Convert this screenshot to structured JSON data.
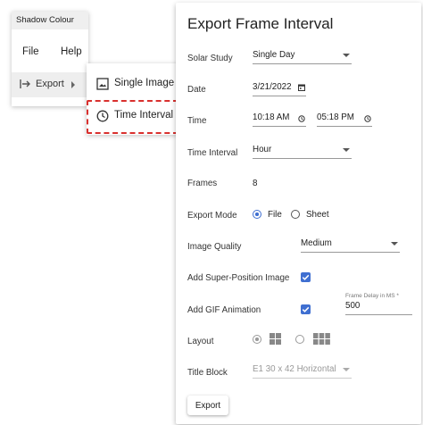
{
  "app": {
    "title": "Shadow Colour",
    "menu": [
      "File",
      "Help"
    ],
    "export_label": "Export"
  },
  "submenu": {
    "items": [
      {
        "label": "Single Image",
        "icon": "image-icon"
      },
      {
        "label": "Time Interval",
        "icon": "clock-icon"
      }
    ],
    "highlight_color": "#d9302e"
  },
  "dialog": {
    "title": "Export Frame Interval",
    "solar_study": {
      "label": "Solar Study",
      "value": "Single Day"
    },
    "date": {
      "label": "Date",
      "value": "3/21/2022"
    },
    "time": {
      "label": "Time",
      "start": "10:18 AM",
      "end": "05:18 PM"
    },
    "time_interval": {
      "label": "Time Interval",
      "value": "Hour"
    },
    "frames": {
      "label": "Frames",
      "value": "8"
    },
    "export_mode": {
      "label": "Export Mode",
      "options": [
        "File",
        "Sheet"
      ],
      "selected": "File"
    },
    "image_quality": {
      "label": "Image Quality",
      "value": "Medium"
    },
    "super_position": {
      "label": "Add Super-Position Image",
      "checked": true
    },
    "gif": {
      "label": "Add GIF Animation",
      "checked": true,
      "delay_label": "Frame Delay in MS *",
      "delay_value": "500"
    },
    "layout": {
      "label": "Layout",
      "selected": 0
    },
    "title_block": {
      "label": "Title Block",
      "value": "E1 30 x 42 Horizontal"
    },
    "export_button": "Export",
    "accent_color": "#3f6fd1"
  }
}
